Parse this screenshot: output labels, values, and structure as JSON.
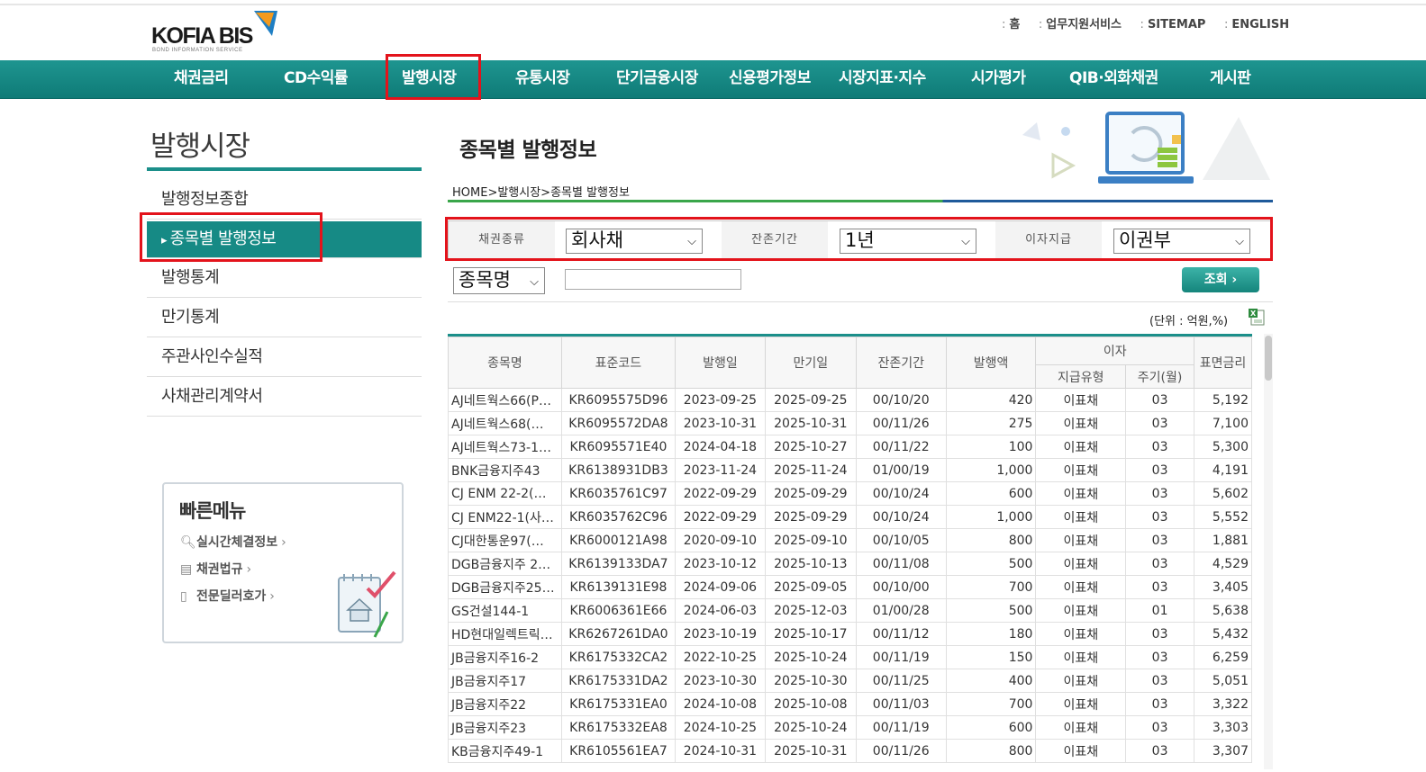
{
  "header": {
    "logo_text": "KOFIA BIS",
    "logo_sub": "BOND INFORMATION SERVICE",
    "util_links": [
      "홈",
      "업무지원서비스",
      "SITEMAP",
      "ENGLISH"
    ]
  },
  "gnb": [
    "채권금리",
    "CD수익률",
    "발행시장",
    "유통시장",
    "단기금융시장",
    "신용평가정보",
    "시장지표·지수",
    "시가평가",
    "QIB·외화채권",
    "게시판"
  ],
  "sidebar": {
    "title": "발행시장",
    "items": [
      "발행정보종합",
      "종목별 발행정보",
      "발행통계",
      "만기통계",
      "주관사인수실적",
      "사채관리계약서"
    ]
  },
  "quick_menu": {
    "title": "빠른메뉴",
    "items": [
      "실시간체결정보",
      "채권법규",
      "전문딜러호가"
    ]
  },
  "main": {
    "title": "종목별 발행정보",
    "breadcrumb": "HOME>발행시장>종목별 발행정보"
  },
  "search": {
    "bond_type_label": "채권종류",
    "bond_type_value": "회사채",
    "term_label": "잔존기간",
    "term_value": "1년",
    "interest_label": "이자지급",
    "interest_value": "이권부",
    "name_select_value": "종목명",
    "name_input_value": "",
    "search_button": "조회 ›"
  },
  "unit_text": "(단위 : 억원,%)",
  "table": {
    "headers": [
      "종목명",
      "표준코드",
      "발행일",
      "만기일",
      "잔존기간",
      "발행액",
      "이자",
      "지급유형",
      "주기(월)",
      "표면금리"
    ],
    "rows": [
      [
        "AJ네트웍스66(P…",
        "KR6095575D96",
        "2023-09-25",
        "2025-09-25",
        "00/10/20",
        "420",
        "이표채",
        "03",
        "5,192"
      ],
      [
        "AJ네트웍스68(…",
        "KR6095572DA8",
        "2023-10-31",
        "2025-10-31",
        "00/11/26",
        "275",
        "이표채",
        "03",
        "7,100"
      ],
      [
        "AJ네트웍스73-1…",
        "KR6095571E40",
        "2024-04-18",
        "2025-10-27",
        "00/11/22",
        "100",
        "이표채",
        "03",
        "5,300"
      ],
      [
        "BNK금융지주43",
        "KR6138931DB3",
        "2023-11-24",
        "2025-11-24",
        "01/00/19",
        "1,000",
        "이표채",
        "03",
        "4,191"
      ],
      [
        "CJ ENM 22-2(…",
        "KR6035761C97",
        "2022-09-29",
        "2025-09-29",
        "00/10/24",
        "600",
        "이표채",
        "03",
        "5,602"
      ],
      [
        "CJ ENM22-1(사…",
        "KR6035762C96",
        "2022-09-29",
        "2025-09-29",
        "00/10/24",
        "1,000",
        "이표채",
        "03",
        "5,552"
      ],
      [
        "CJ대한통운97(…",
        "KR6000121A98",
        "2020-09-10",
        "2025-09-10",
        "00/10/05",
        "800",
        "이표채",
        "03",
        "1,881"
      ],
      [
        "DGB금융지주 2…",
        "KR6139133DA7",
        "2023-10-12",
        "2025-10-13",
        "00/11/08",
        "500",
        "이표채",
        "03",
        "4,529"
      ],
      [
        "DGB금융지주25…",
        "KR6139131E98",
        "2024-09-06",
        "2025-09-05",
        "00/10/00",
        "700",
        "이표채",
        "03",
        "3,405"
      ],
      [
        "GS건설144-1",
        "KR6006361E66",
        "2024-06-03",
        "2025-12-03",
        "01/00/28",
        "500",
        "이표채",
        "01",
        "5,638"
      ],
      [
        "HD현대일렉트릭…",
        "KR6267261DA0",
        "2023-10-19",
        "2025-10-17",
        "00/11/12",
        "180",
        "이표채",
        "03",
        "5,432"
      ],
      [
        "JB금융지주16-2",
        "KR6175332CA2",
        "2022-10-25",
        "2025-10-24",
        "00/11/19",
        "150",
        "이표채",
        "03",
        "6,259"
      ],
      [
        "JB금융지주17",
        "KR6175331DA2",
        "2023-10-30",
        "2025-10-30",
        "00/11/25",
        "400",
        "이표채",
        "03",
        "5,051"
      ],
      [
        "JB금융지주22",
        "KR6175331EA0",
        "2024-10-08",
        "2025-10-08",
        "00/11/03",
        "700",
        "이표채",
        "03",
        "3,322"
      ],
      [
        "JB금융지주23",
        "KR6175332EA8",
        "2024-10-25",
        "2025-10-24",
        "00/11/19",
        "600",
        "이표채",
        "03",
        "3,303"
      ],
      [
        "KB금융지주49-1",
        "KR6105561EA7",
        "2024-10-31",
        "2025-10-31",
        "00/11/26",
        "800",
        "이표채",
        "03",
        "3,307"
      ]
    ]
  },
  "colors": {
    "accent": "#168a85",
    "highlight_box": "#e3131b"
  }
}
